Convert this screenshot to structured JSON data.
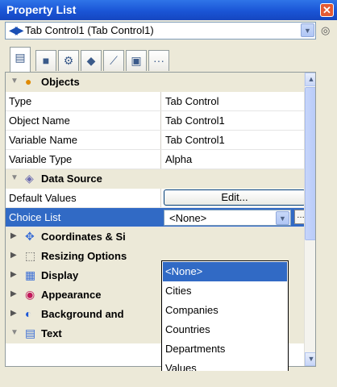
{
  "window": {
    "title": "Property List",
    "close": "✕"
  },
  "selector": {
    "arrows": "◀▶",
    "value": "Tab Control1 (Tab Control1)"
  },
  "tabs": [
    {
      "name": "list-tab",
      "glyph": "▤"
    },
    {
      "name": "object-tab",
      "glyph": "■"
    },
    {
      "name": "gear-tab",
      "glyph": "⚙"
    },
    {
      "name": "shapes-tab",
      "glyph": "◆"
    },
    {
      "name": "chart-tab",
      "glyph": "⟋"
    },
    {
      "name": "monitor-tab",
      "glyph": "▣"
    },
    {
      "name": "more-tab",
      "glyph": "···"
    }
  ],
  "sections": {
    "objects": "Objects",
    "data_source": "Data Source",
    "coordinates": "Coordinates & Si",
    "resizing": "Resizing Options",
    "display": "Display",
    "appearance": "Appearance",
    "background": "Background and",
    "text": "Text"
  },
  "properties": {
    "type": {
      "k": "Type",
      "v": "Tab Control"
    },
    "object_name": {
      "k": "Object Name",
      "v": "Tab Control1"
    },
    "variable_name": {
      "k": "Variable Name",
      "v": "Tab Control1"
    },
    "variable_type": {
      "k": "Variable Type",
      "v": "Alpha"
    },
    "default_values": {
      "k": "Default Values",
      "v": "Edit..."
    },
    "choice_list": {
      "k": "Choice List",
      "v": "<None>"
    }
  },
  "dropdown_options": [
    "<None>",
    "Cities",
    "Companies",
    "Countries",
    "Departments",
    "Values"
  ],
  "dropdown_selected": "<None>"
}
